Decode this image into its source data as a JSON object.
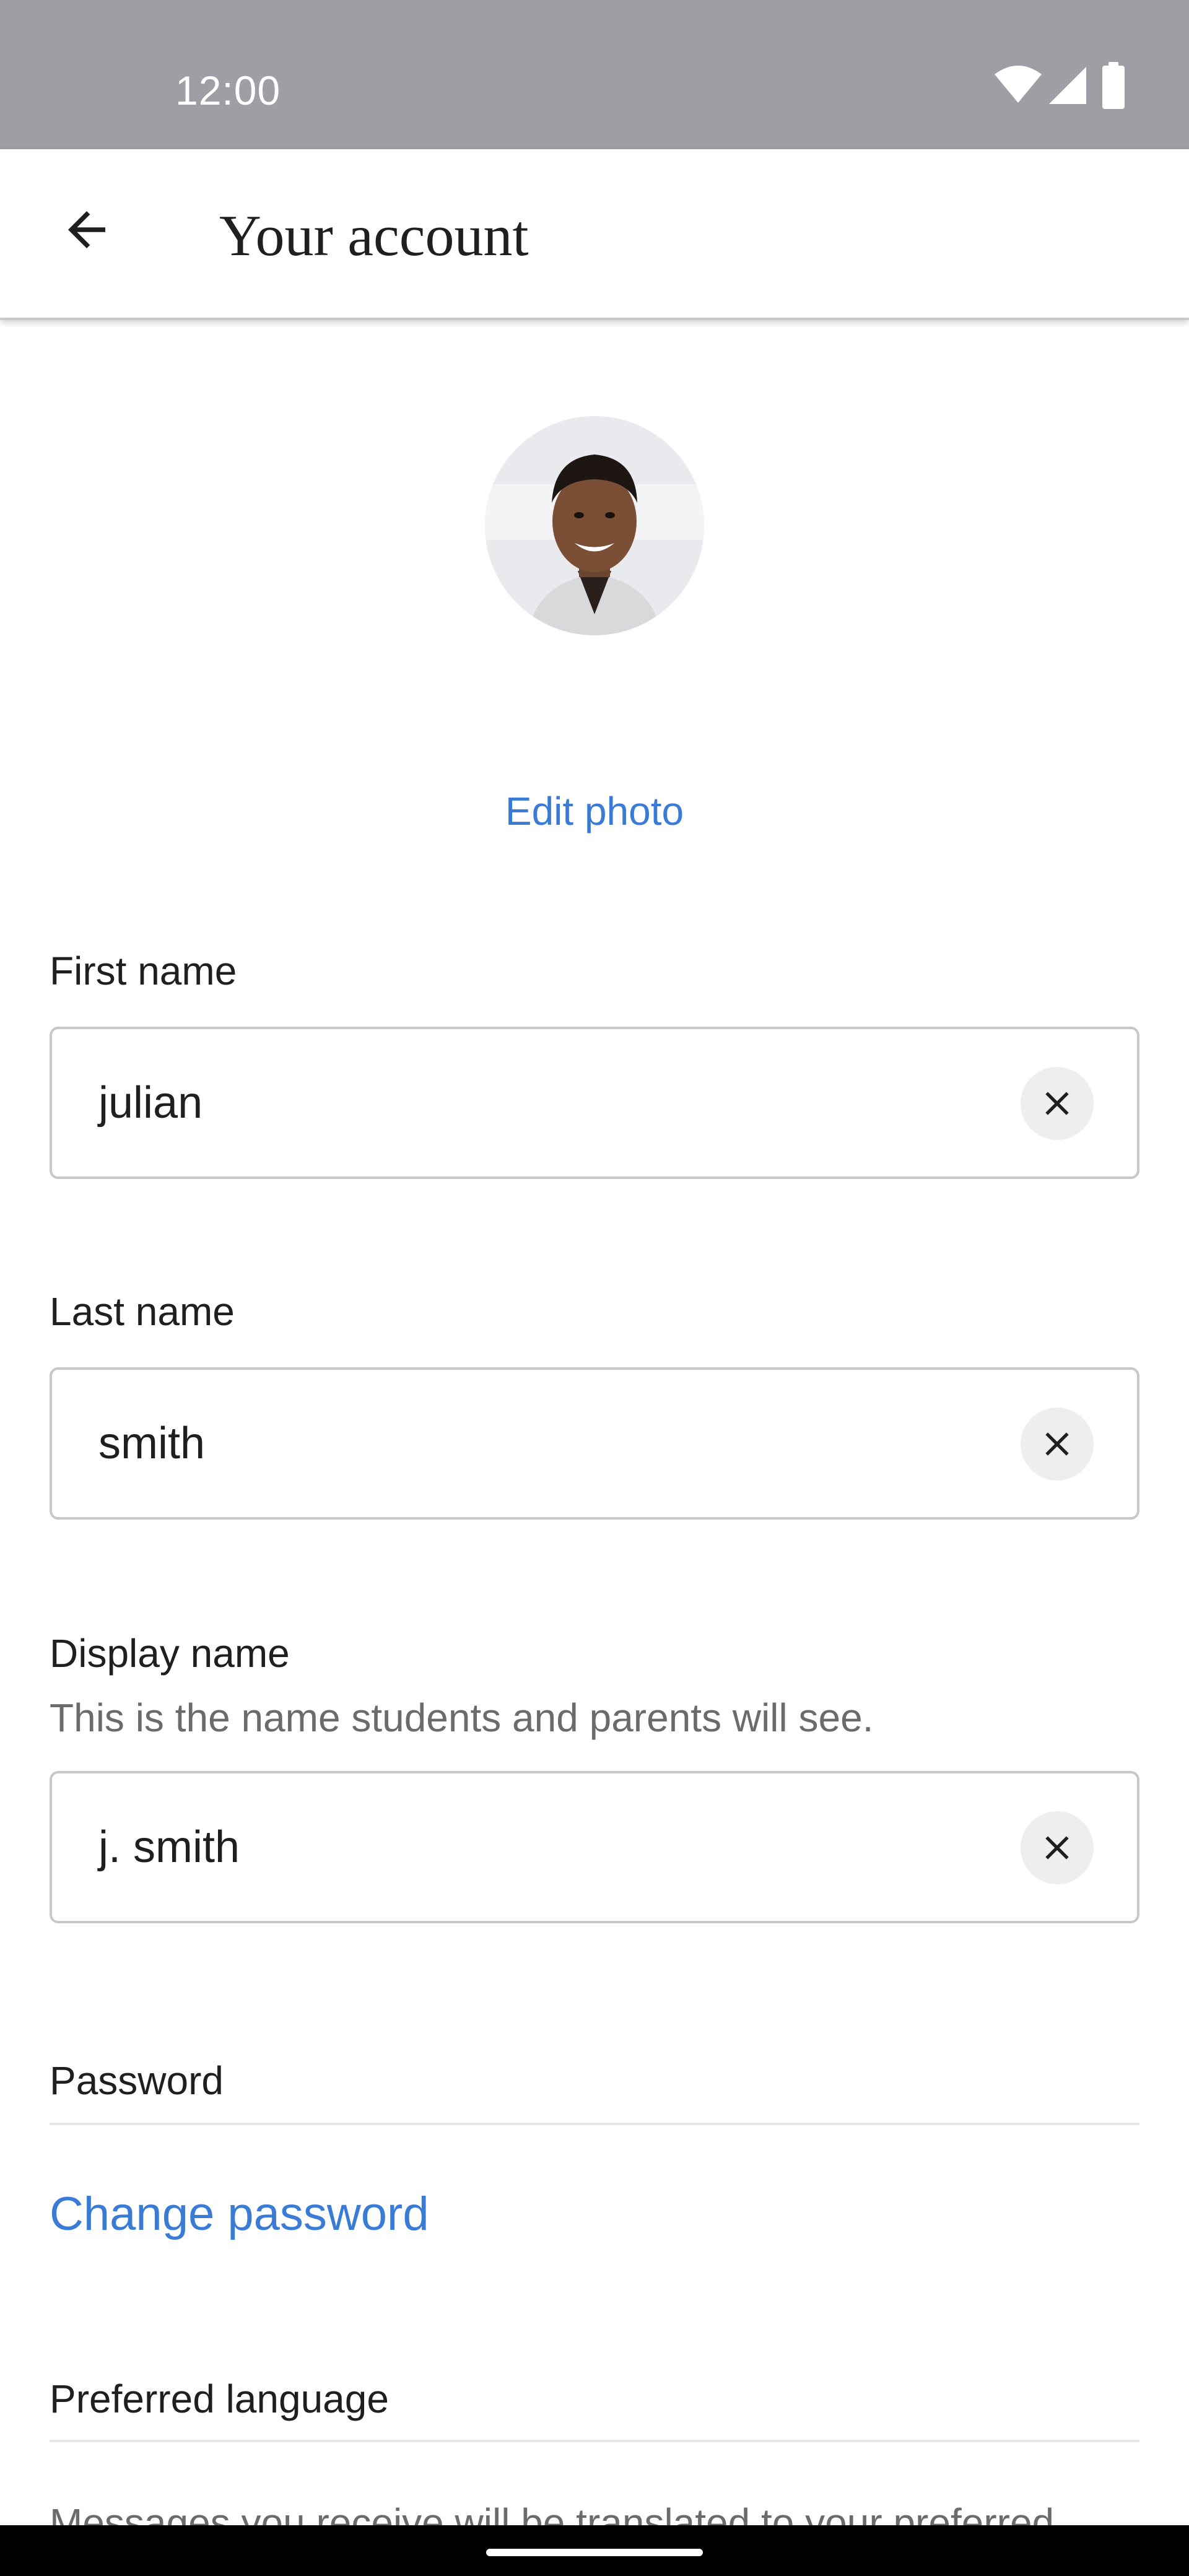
{
  "status_bar": {
    "time": "12:00",
    "icons": [
      "wifi-icon",
      "cellular-signal-icon",
      "battery-icon"
    ]
  },
  "app_bar": {
    "back_icon": "arrow-left-icon",
    "title": "Your account"
  },
  "profile": {
    "avatar": "profile-photo",
    "edit_photo_label": "Edit photo"
  },
  "form": {
    "first_name": {
      "label": "First name",
      "value": "julian",
      "clear_icon": "close-icon"
    },
    "last_name": {
      "label": "Last name",
      "value": "smith",
      "clear_icon": "close-icon"
    },
    "display_name": {
      "label": "Display name",
      "help": "This is the name students and parents will see.",
      "value": "j. smith",
      "clear_icon": "close-icon"
    }
  },
  "password_section": {
    "heading": "Password",
    "change_password_label": "Change password"
  },
  "language_section": {
    "heading": "Preferred language",
    "description": "Messages you receive will be translated to your preferred"
  },
  "colors": {
    "accent": "#3a7bd5",
    "status_bar": "#9e9fa4",
    "field_border": "#c8c8c8",
    "clear_button_bg": "#eeeeee"
  }
}
